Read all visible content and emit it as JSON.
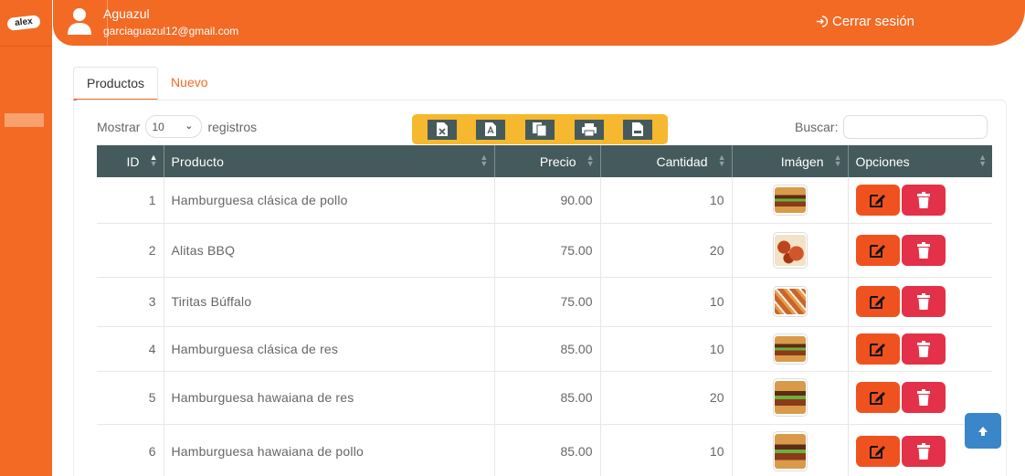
{
  "sidebar": {
    "logo_text": "alex"
  },
  "header": {
    "user_name": "Aguazul",
    "user_email": "garciaguazul12@gmail.com",
    "logout_label": "Cerrar sesión"
  },
  "tabs": [
    {
      "label": "Productos",
      "active": true
    },
    {
      "label": "Nuevo",
      "active": false
    }
  ],
  "controls": {
    "show_prefix": "Mostrar",
    "show_value": "10",
    "show_suffix": "registros",
    "search_label": "Buscar:",
    "search_value": "",
    "export_buttons": [
      "excel-icon",
      "pdf-icon",
      "copy-icon",
      "print-icon",
      "csv-icon"
    ]
  },
  "table": {
    "columns": [
      "ID",
      "Producto",
      "Precio",
      "Cantidad",
      "Imágen",
      "Opciones"
    ],
    "rows": [
      {
        "id": "1",
        "product": "Hamburguesa clásica de pollo",
        "price": "90.00",
        "qty": "10",
        "image": "burger"
      },
      {
        "id": "2",
        "product": "Alitas BBQ",
        "price": "75.00",
        "qty": "20",
        "image": "wings"
      },
      {
        "id": "3",
        "product": "Tiritas Búffalo",
        "price": "75.00",
        "qty": "10",
        "image": "strips"
      },
      {
        "id": "4",
        "product": "Hamburguesa clásica de res",
        "price": "85.00",
        "qty": "10",
        "image": "burger"
      },
      {
        "id": "5",
        "product": "Hamburguesa hawaiana de res",
        "price": "85.00",
        "qty": "20",
        "image": "burger"
      },
      {
        "id": "6",
        "product": "Hamburguesa hawaiana de pollo",
        "price": "85.00",
        "qty": "10",
        "image": "burger"
      }
    ]
  },
  "colors": {
    "brand": "#f26a24",
    "header_row": "#455a5c",
    "export_bar": "#f5b82e",
    "edit": "#f0521f",
    "delete": "#e23148",
    "scroll_top": "#3a86c8"
  }
}
